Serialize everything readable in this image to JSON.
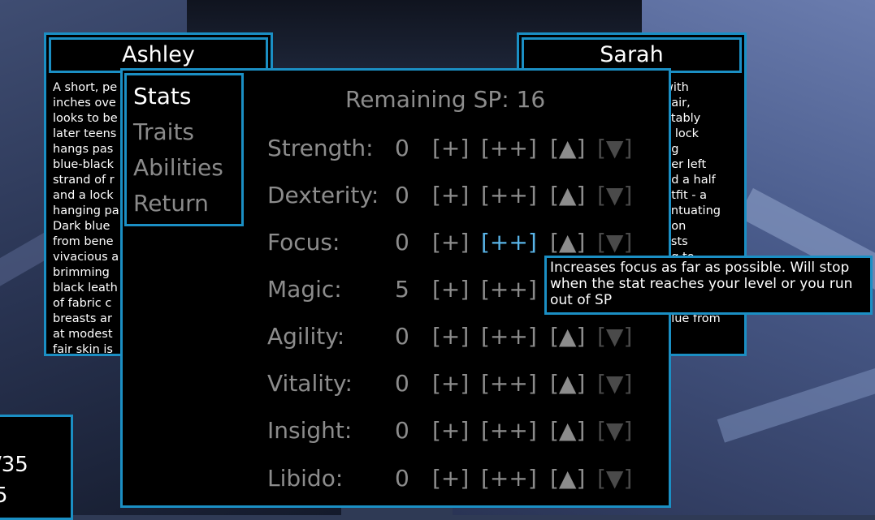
{
  "characters": {
    "left": {
      "name": "Ashley",
      "description": "A short, pe\ninches ove\nlooks to be\nlater teens\nhangs pas\nblue-black\nstrand of r\nand a lock\nhanging pa\nDark blue\nfrom bene\nvivacious a\nbrimming\nblack leath\nof fabric c\nbreasts ar\nat modest\nfair skin is"
    },
    "right": {
      "name": "Sarah",
      "description": "with\nhair,\notably\ng lock\nng\nher left\nnd a half\nutfit - a\nentuating\npon\nasts\nng to\nu to\nwith her\ns eyes\nblue from"
    }
  },
  "menu": {
    "items": [
      "Stats",
      "Traits",
      "Abilities",
      "Return"
    ],
    "active": "Stats"
  },
  "stats_panel": {
    "remaining_sp": "Remaining SP: 16",
    "buttons": {
      "plus": "[+]",
      "plus_plus": "[++]",
      "up": "[▲]",
      "down": "[▼]"
    },
    "rows": [
      {
        "label": "Strength:",
        "value": "0"
      },
      {
        "label": "Dexterity:",
        "value": "0"
      },
      {
        "label": "Focus:",
        "value": "0"
      },
      {
        "label": "Magic:",
        "value": "5"
      },
      {
        "label": "Agility:",
        "value": "0"
      },
      {
        "label": "Vitality:",
        "value": "0"
      },
      {
        "label": "Insight:",
        "value": "0"
      },
      {
        "label": "Libido:",
        "value": "0"
      }
    ]
  },
  "tooltip": {
    "text": "Increases focus as far as possible. Will stop when the stat reaches your level or you run out of SP"
  },
  "corner_panel": {
    "line1": "/35",
    "line2": "5"
  },
  "colors": {
    "accent": "#1b8fc4",
    "highlight": "#59b4e8",
    "text_dim": "#8c8c8c"
  }
}
